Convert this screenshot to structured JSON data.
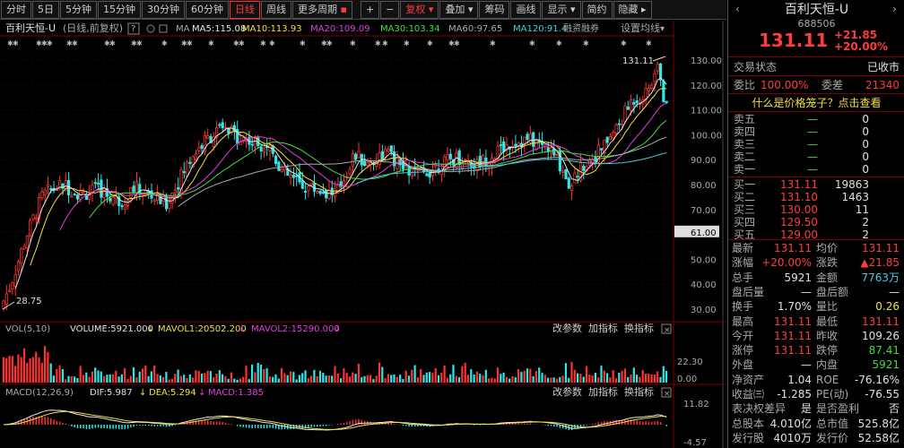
{
  "toolbar": {
    "periods": [
      "分时",
      "5日",
      "5分钟",
      "15分钟",
      "30分钟",
      "60分钟",
      "日线",
      "周线",
      "更多周期"
    ],
    "active_period": "日线",
    "plus": "+",
    "minus": "−",
    "adjust": "复权",
    "overlay": "叠加",
    "chips": "筹码",
    "draw": "画线",
    "display": "显示",
    "brief": "简约",
    "hide": "隐藏"
  },
  "chart": {
    "title": "百利天恒-U",
    "subtitle": "(日线,前复权)",
    "help": "?",
    "ma_label": "MA",
    "ma": [
      {
        "label": "MA5:115.08",
        "color": "#e8e8e8"
      },
      {
        "label": "MA10:113.93",
        "color": "#f0e040"
      },
      {
        "label": "MA20:109.09",
        "color": "#e040e0"
      },
      {
        "label": "MA30:103.34",
        "color": "#40e040"
      },
      {
        "label": "MA60:97.65",
        "color": "#aaaaaa"
      },
      {
        "label": "MA120:91.4",
        "color": "#40d0e0"
      }
    ],
    "margin_tag": "融资融券",
    "set_ma": "设置均线",
    "high_label": "131.11",
    "low_label": "28.75",
    "y_ticks": [
      "130.00",
      "120.00",
      "110.00",
      "100.00",
      "90.00",
      "80.00",
      "70.00",
      "61.00",
      "50.00",
      "40.00",
      "30.00"
    ],
    "vol": {
      "label": "VOL(5,10)",
      "volume": "VOLUME:5921.000",
      "mavol1": "MAVOL1:20502.200",
      "mavol2": "MAVOL2:15290.000",
      "btn_params": "改参数",
      "btn_add": "加指标",
      "btn_switch": "换指标",
      "y_ticks": [
        "22.30",
        "0.00"
      ]
    },
    "macd": {
      "label": "MACD(12,26,9)",
      "dif": "DIF:5.987",
      "dea": "DEA:5.294",
      "macd": "MACD:1.385",
      "btn_params": "改参数",
      "btn_add": "加指标",
      "btn_switch": "换指标",
      "y_ticks": [
        "11.82",
        "-4.57"
      ]
    }
  },
  "panel": {
    "name": "百利天恒-U",
    "code": "688506",
    "price": "131.11",
    "change": "+21.85",
    "change_pct": "+20.00%",
    "status_label": "交易状态",
    "status_value": "已收市",
    "ratio_label": "委比",
    "ratio_value": "100.00%",
    "diff_label": "委差",
    "diff_value": "21340",
    "cage_link": "什么是价格笼子？点击查看",
    "asks": [
      {
        "label": "卖五",
        "price": "—",
        "vol": "0"
      },
      {
        "label": "卖四",
        "price": "—",
        "vol": "0"
      },
      {
        "label": "卖三",
        "price": "—",
        "vol": "0"
      },
      {
        "label": "卖二",
        "price": "—",
        "vol": "0"
      },
      {
        "label": "卖一",
        "price": "—",
        "vol": "0"
      }
    ],
    "bids": [
      {
        "label": "买一",
        "price": "131.11",
        "vol": "19863"
      },
      {
        "label": "买二",
        "price": "131.10",
        "vol": "1463"
      },
      {
        "label": "买三",
        "price": "130.00",
        "vol": "11"
      },
      {
        "label": "买四",
        "price": "129.50",
        "vol": "2"
      },
      {
        "label": "买五",
        "price": "129.00",
        "vol": "2"
      }
    ],
    "stats": [
      {
        "l1": "最新",
        "v1": "131.11",
        "c1": "r",
        "l2": "均价",
        "v2": "131.11",
        "c2": "r"
      },
      {
        "l1": "涨幅",
        "v1": "+20.00%",
        "c1": "r",
        "l2": "涨跌",
        "v2": "▲21.85",
        "c2": "r"
      },
      {
        "l1": "总手",
        "v1": "5921",
        "c1": "w",
        "l2": "金额",
        "v2": "7763万",
        "c2": "cy"
      },
      {
        "l1": "盘后量",
        "v1": "—",
        "c1": "w",
        "l2": "盘后额",
        "v2": "—",
        "c2": "w"
      },
      {
        "l1": "换手",
        "v1": "1.70%",
        "c1": "w",
        "l2": "量比",
        "v2": "0.26",
        "c2": "y"
      },
      {
        "l1": "最高",
        "v1": "131.11",
        "c1": "r",
        "l2": "最低",
        "v2": "131.11",
        "c2": "r"
      },
      {
        "l1": "今开",
        "v1": "131.11",
        "c1": "r",
        "l2": "昨收",
        "v2": "109.26",
        "c2": "w"
      },
      {
        "l1": "涨停",
        "v1": "131.11",
        "c1": "r",
        "l2": "跌停",
        "v2": "87.41",
        "c2": "g"
      },
      {
        "l1": "外盘",
        "v1": "—",
        "c1": "w",
        "l2": "内盘",
        "v2": "5921",
        "c2": "g"
      },
      {
        "l1": "净资产",
        "v1": "1.04",
        "c1": "w",
        "l2": "ROE",
        "v2": "-76.16%",
        "c2": "w"
      },
      {
        "l1": "收益㈢",
        "v1": "-1.285",
        "c1": "w",
        "l2": "PE(动)",
        "v2": "-76.55",
        "c2": "w"
      },
      {
        "l1": "表决权差异",
        "v1": "是",
        "c1": "w",
        "l2": "是否盈利",
        "v2": "否",
        "c2": "w"
      },
      {
        "l1": "总股本",
        "v1": "4.010亿",
        "c1": "w",
        "l2": "总市值",
        "v2": "525.8亿",
        "c2": "w"
      },
      {
        "l1": "发行股",
        "v1": "4010万",
        "c1": "w",
        "l2": "发行价",
        "v2": "52.58亿",
        "c2": "w"
      }
    ]
  }
}
